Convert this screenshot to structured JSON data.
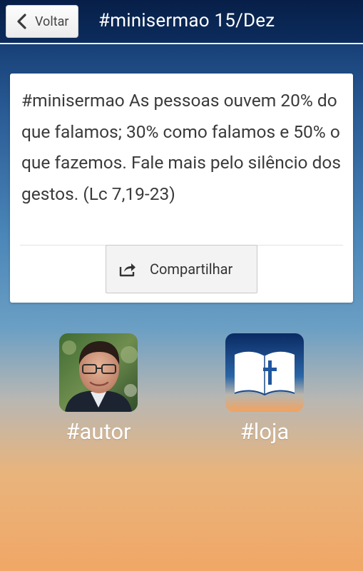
{
  "header": {
    "back_label": "Voltar",
    "title": "#minisermao 15/Dez"
  },
  "card": {
    "message": "#minisermao As pessoas ouvem 20% do que falamos; 30% como falamos e 50% o que fazemos. Fale mais pelo silêncio dos gestos. (Lc 7,19-23)",
    "share_label": "Compartilhar"
  },
  "tiles": {
    "autor": {
      "label": "#autor",
      "icon": "author-photo"
    },
    "loja": {
      "label": "#loja",
      "icon": "bible-book-icon"
    }
  },
  "colors": {
    "header_background": "#0c2c5d",
    "gradient_top": "#173f77",
    "gradient_bottom": "#f1a766",
    "card_background": "#ffffff"
  }
}
